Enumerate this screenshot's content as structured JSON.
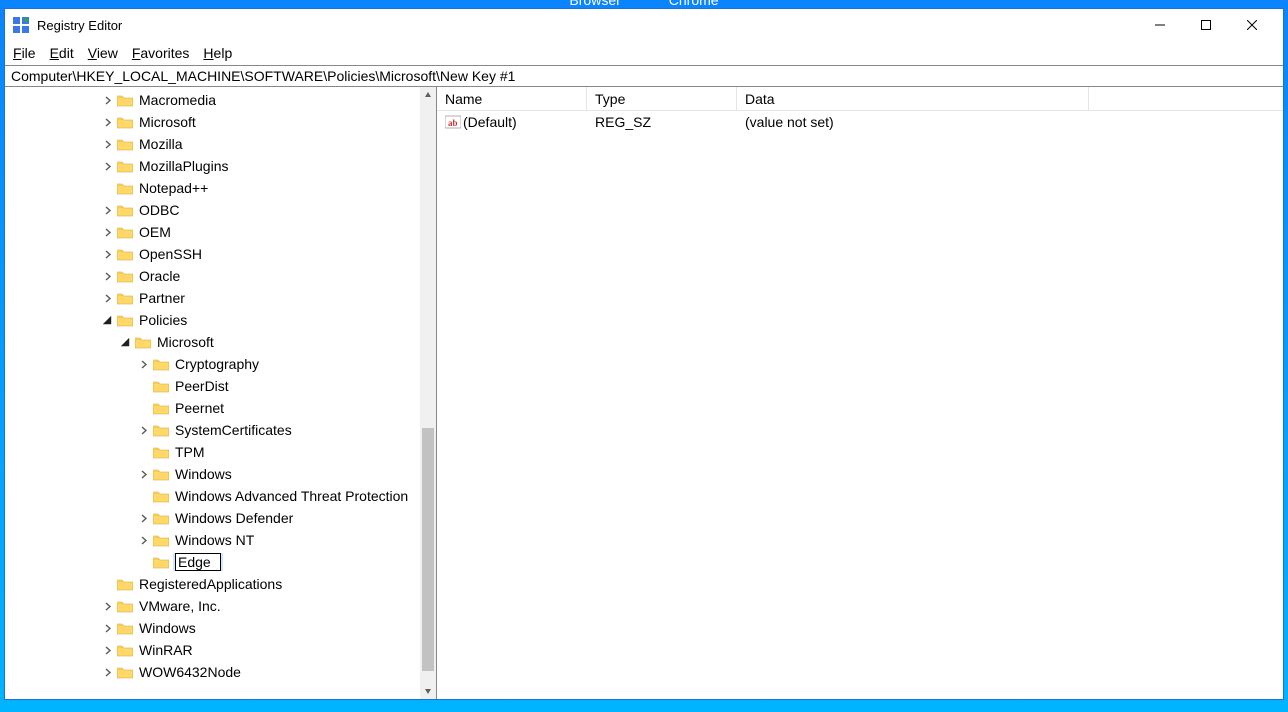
{
  "external_tabs": {
    "a": "Browser",
    "b": "Chrome"
  },
  "window": {
    "title": "Registry Editor"
  },
  "menu": {
    "file": "File",
    "edit": "Edit",
    "view": "View",
    "favorites": "Favorites",
    "help": "Help"
  },
  "address": "Computer\\HKEY_LOCAL_MACHINE\\SOFTWARE\\Policies\\Microsoft\\New Key #1",
  "tree": [
    {
      "indent": 4,
      "exp": "closed",
      "label": "Macromedia"
    },
    {
      "indent": 4,
      "exp": "closed",
      "label": "Microsoft"
    },
    {
      "indent": 4,
      "exp": "closed",
      "label": "Mozilla"
    },
    {
      "indent": 4,
      "exp": "closed",
      "label": "MozillaPlugins"
    },
    {
      "indent": 4,
      "exp": "none",
      "label": "Notepad++"
    },
    {
      "indent": 4,
      "exp": "closed",
      "label": "ODBC"
    },
    {
      "indent": 4,
      "exp": "closed",
      "label": "OEM"
    },
    {
      "indent": 4,
      "exp": "closed",
      "label": "OpenSSH"
    },
    {
      "indent": 4,
      "exp": "closed",
      "label": "Oracle"
    },
    {
      "indent": 4,
      "exp": "closed",
      "label": "Partner"
    },
    {
      "indent": 4,
      "exp": "open",
      "label": "Policies"
    },
    {
      "indent": 5,
      "exp": "open",
      "label": "Microsoft"
    },
    {
      "indent": 6,
      "exp": "closed",
      "label": "Cryptography"
    },
    {
      "indent": 6,
      "exp": "none",
      "label": "PeerDist"
    },
    {
      "indent": 6,
      "exp": "none",
      "label": "Peernet"
    },
    {
      "indent": 6,
      "exp": "closed",
      "label": "SystemCertificates"
    },
    {
      "indent": 6,
      "exp": "none",
      "label": "TPM"
    },
    {
      "indent": 6,
      "exp": "closed",
      "label": "Windows"
    },
    {
      "indent": 6,
      "exp": "none",
      "label": "Windows Advanced Threat Protection"
    },
    {
      "indent": 6,
      "exp": "closed",
      "label": "Windows Defender"
    },
    {
      "indent": 6,
      "exp": "closed",
      "label": "Windows NT"
    },
    {
      "indent": 6,
      "exp": "none",
      "label": "Edge",
      "editing": true,
      "selected": true
    },
    {
      "indent": 4,
      "exp": "none",
      "label": "RegisteredApplications"
    },
    {
      "indent": 4,
      "exp": "closed",
      "label": "VMware, Inc."
    },
    {
      "indent": 4,
      "exp": "closed",
      "label": "Windows"
    },
    {
      "indent": 4,
      "exp": "closed",
      "label": "WinRAR"
    },
    {
      "indent": 4,
      "exp": "closed",
      "label": "WOW6432Node"
    }
  ],
  "list": {
    "headers": {
      "name": "Name",
      "type": "Type",
      "data": "Data"
    },
    "rows": [
      {
        "name": "(Default)",
        "type": "REG_SZ",
        "data": "(value not set)"
      }
    ]
  },
  "scrollbar": {
    "thumb_top_pct": 56,
    "thumb_height_pct": 42
  }
}
